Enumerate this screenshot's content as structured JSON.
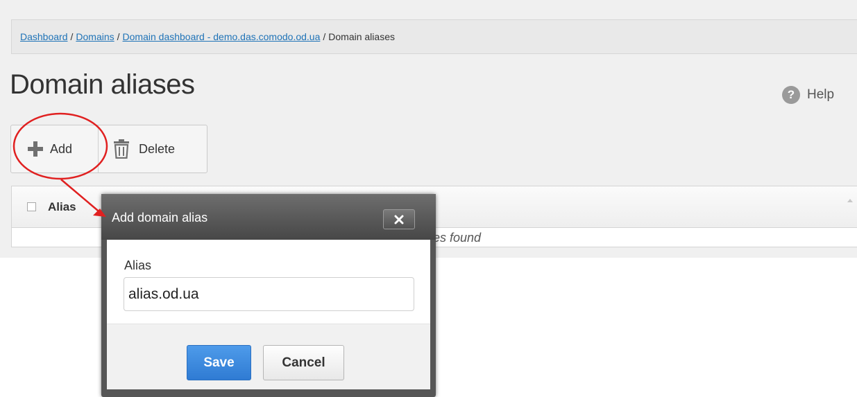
{
  "breadcrumb": {
    "items": [
      "Dashboard",
      "Domains",
      "Domain dashboard - demo.das.comodo.od.ua"
    ],
    "current": "Domain aliases",
    "separator": "/"
  },
  "page": {
    "title": "Domain aliases",
    "help_label": "Help",
    "help_icon": "?"
  },
  "toolbar": {
    "add_label": "Add",
    "delete_label": "Delete"
  },
  "table": {
    "column": "Alias",
    "empty_text": "No aliases found"
  },
  "modal": {
    "title": "Add domain alias",
    "close_label": "close",
    "field_label": "Alias",
    "field_value": "alias.od.ua",
    "save_label": "Save",
    "cancel_label": "Cancel"
  },
  "colors": {
    "link": "#1f73b7",
    "save": "#3a86dd",
    "annotation": "#e02020",
    "modal_header": "#565656"
  }
}
